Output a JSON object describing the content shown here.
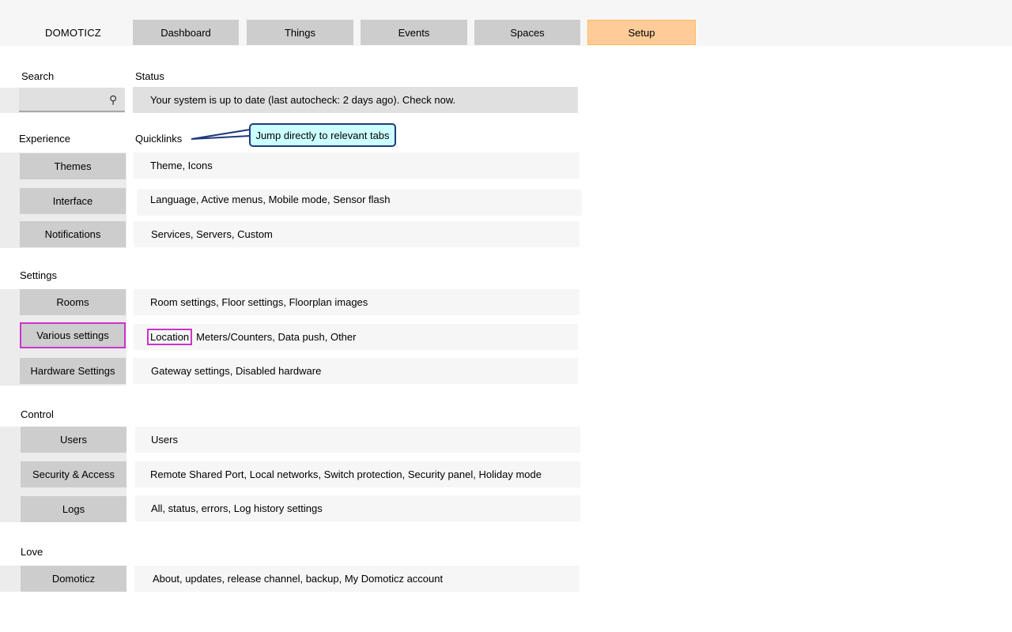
{
  "app": {
    "title": "DOMOTICZ"
  },
  "tabs": [
    {
      "label": "Dashboard"
    },
    {
      "label": "Things"
    },
    {
      "label": "Events"
    },
    {
      "label": "Spaces"
    },
    {
      "label": "Setup",
      "active": true
    }
  ],
  "search": {
    "label": "Search",
    "value": "",
    "placeholder": "",
    "icon": "search-icon"
  },
  "status": {
    "label": "Status",
    "text": "Your system is up to date (last autocheck: 2 days ago). Check now."
  },
  "quicklinks": {
    "label": "Quicklinks",
    "callout": "Jump directly to relevant tabs"
  },
  "sections": {
    "experience": {
      "label": "Experience",
      "items": [
        {
          "label": "Themes",
          "links": "Theme, Icons"
        },
        {
          "label": "Interface",
          "links": "Language, Active menus, Mobile mode, Sensor flash"
        },
        {
          "label": "Notifications",
          "links": "Services, Servers, Custom"
        }
      ]
    },
    "settings": {
      "label": "Settings",
      "items": [
        {
          "label": "Rooms",
          "links": "Room settings, Floor settings, Floorplan images"
        },
        {
          "label": "Various settings",
          "links_first": "Location",
          "links": "Meters/Counters, Data push, Other"
        },
        {
          "label": "Hardware Settings",
          "links": "Gateway settings, Disabled hardware"
        }
      ]
    },
    "control": {
      "label": "Control",
      "items": [
        {
          "label": "Users",
          "links": "Users"
        },
        {
          "label": "Security & Access",
          "links": "Remote Shared Port, Local networks, Switch protection, Security panel, Holiday mode"
        },
        {
          "label": "Logs",
          "links": "All, status, errors, Log history settings"
        }
      ]
    },
    "love": {
      "label": "Love",
      "items": [
        {
          "label": "Domoticz",
          "links": "About, updates, release channel, backup, My Domoticz account"
        }
      ]
    }
  },
  "colors": {
    "active_tab": "#ffcc99",
    "highlight": "#cc33cc",
    "callout_bg": "#ccffff",
    "callout_border": "#1f3a7a"
  }
}
